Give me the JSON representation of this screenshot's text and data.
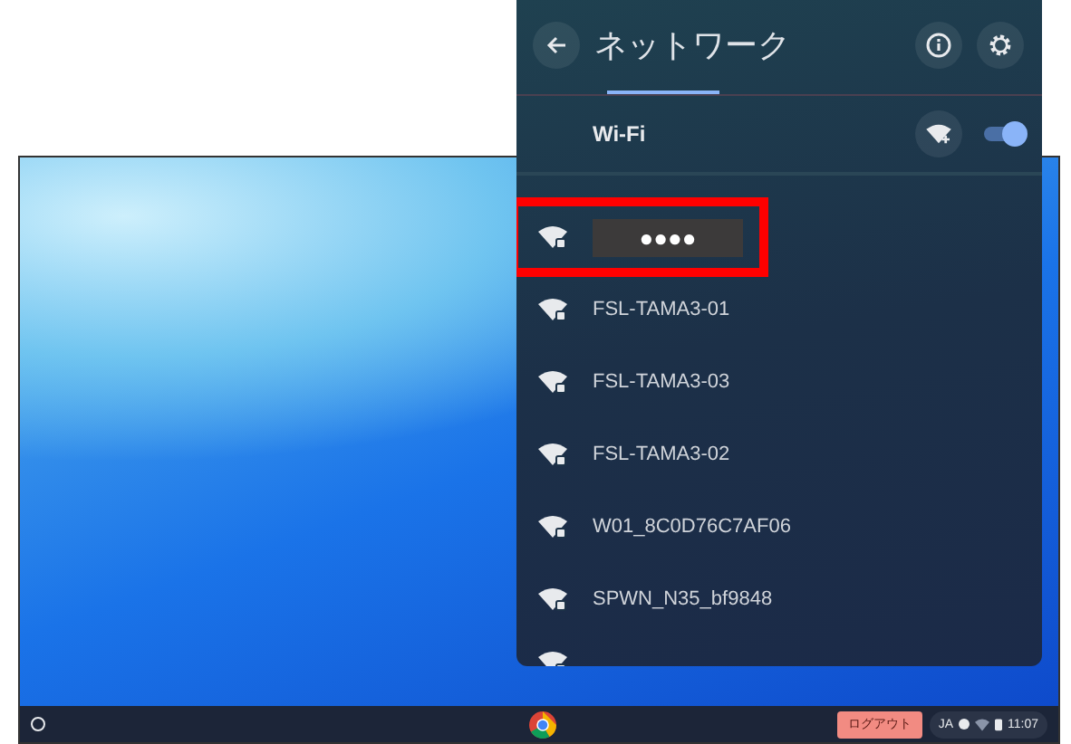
{
  "panel": {
    "title": "ネットワーク",
    "wifi_label": "Wi-Fi",
    "wifi_on": true
  },
  "networks": [
    {
      "name": "●●●●",
      "kind": "masked",
      "highlighted": true
    },
    {
      "name": "FSL-TAMA3-01",
      "kind": "plain",
      "highlighted": false
    },
    {
      "name": "FSL-TAMA3-03",
      "kind": "plain",
      "highlighted": false
    },
    {
      "name": "FSL-TAMA3-02",
      "kind": "plain",
      "highlighted": false
    },
    {
      "name": "W01_8C0D76C7AF06",
      "kind": "plain",
      "highlighted": false
    },
    {
      "name": "SPWN_N35_bf9848",
      "kind": "plain",
      "highlighted": false
    }
  ],
  "taskbar": {
    "logout": "ログアウト",
    "ime": "JA",
    "time": "11:07"
  }
}
